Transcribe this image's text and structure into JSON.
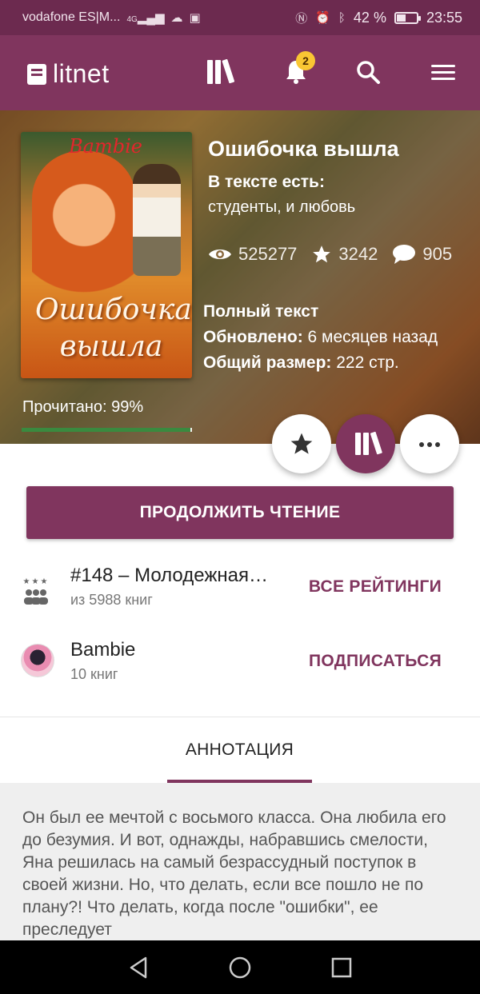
{
  "status_bar": {
    "carrier": "vodafone ES|M...",
    "network": "4G",
    "battery_percent": "42 %",
    "battery_level": 0.42,
    "time": "23:55"
  },
  "app_bar": {
    "logo_text": "litnet",
    "notification_count": "2"
  },
  "book": {
    "cover_author": "Bambie",
    "cover_title": "Ошибочка вышла",
    "title": "Ошибочка вышла",
    "tags_label": "В тексте есть:",
    "tags": "студенты, и любовь",
    "views": "525277",
    "likes": "3242",
    "comments": "905",
    "status": "Полный текст",
    "updated_label": "Обновлено:",
    "updated_value": "6 месяцев назад",
    "size_label": "Общий размер:",
    "size_value": "222 стр.",
    "progress_label": "Прочитано: 99%",
    "progress": 0.99
  },
  "actions": {
    "continue_label": "ПРОДОЛЖИТЬ ЧТЕНИЕ"
  },
  "rating": {
    "title": "#148 – Молодежная…",
    "subtitle": "из 5988 книг",
    "action": "ВСЕ РЕЙТИНГИ"
  },
  "author": {
    "name": "Bambie",
    "books": "10 книг",
    "action": "ПОДПИСАТЬСЯ"
  },
  "tabs": {
    "annotation": "АННОТАЦИЯ"
  },
  "annotation_text": "Он был ее мечтой с восьмого класса. Она любила его до безумия. И вот, однажды, набравшись смелости, Яна решилась на самый безрассудный поступок в своей жизни. Но, что делать, если все пошло не по плану?! Что делать, когда после \"ошибки\", ее преследует",
  "colors": {
    "brand": "#80355e",
    "status_bar": "#6c2a4f",
    "progress": "#3a8a3f",
    "badge": "#f9c633"
  }
}
